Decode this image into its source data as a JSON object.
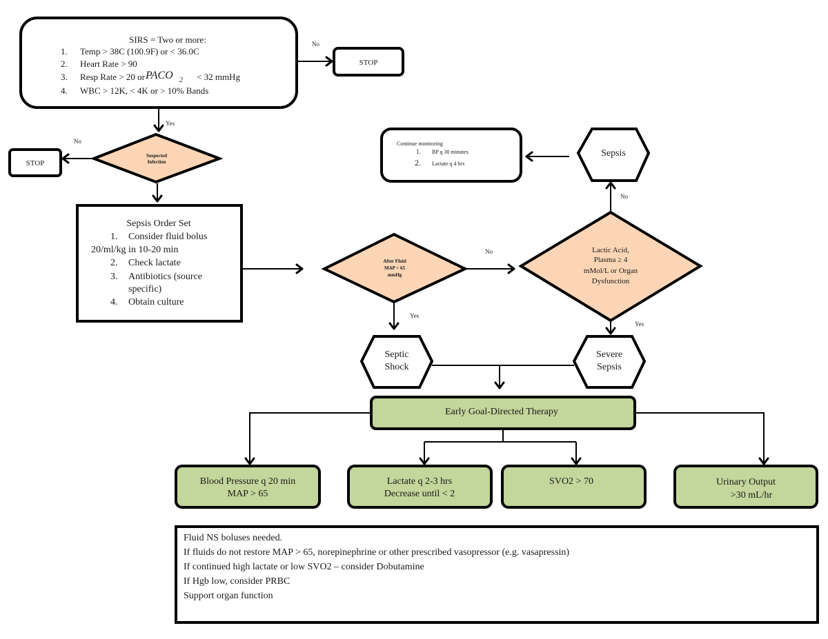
{
  "colors": {
    "decision_fill": "#fbd5b5",
    "therapy_fill": "#c3d69b",
    "stroke": "#000000"
  },
  "sirs": {
    "title": "SIRS = Two or more:",
    "items": [
      {
        "num": "1.",
        "text": "Temp > 38C (100.9F) or < 36.0C"
      },
      {
        "num": "2.",
        "text": "Heart Rate > 90"
      },
      {
        "num": "3.",
        "text": "Resp Rate > 20 or",
        "formula": "PACO",
        "formula_sub": "2",
        "suffix": "< 32 mmHg"
      },
      {
        "num": "4.",
        "text": "WBC > 12K, < 4K or > 10% Bands"
      }
    ]
  },
  "stop_top": {
    "label": "STOP"
  },
  "stop_left": {
    "label": "STOP"
  },
  "suspected_infection": {
    "line1": "Suspected",
    "line2": "Infection"
  },
  "order_set": {
    "title": "Sepsis Order Set",
    "item1_num": "1.",
    "item1_line1": "Consider fluid bolus",
    "item1_line2": "20/ml/kg in 10-20 min",
    "item2_num": "2.",
    "item2": "Check lactate",
    "item3_num": "3.",
    "item3_line1": "Antibiotics (source",
    "item3_line2": "specific)",
    "item4_num": "4.",
    "item4": "Obtain culture"
  },
  "after_fluid": {
    "line1": "After Fluid",
    "line2": "MAP < 65",
    "line3": "mmHg"
  },
  "lactic": {
    "line1": "Lactic Acid,",
    "line2": "Plasma ≥ 4",
    "line3": "mMol/L or Organ",
    "line4": "Dysfunction"
  },
  "sepsis": {
    "label": "Sepsis"
  },
  "continue_monitoring": {
    "title": "Continue monitoring",
    "items": [
      {
        "num": "1.",
        "text": "BP q 30 minutes"
      },
      {
        "num": "2.",
        "text": "Lactate q 4 hrs"
      }
    ]
  },
  "septic_shock": {
    "line1": "Septic",
    "line2": "Shock"
  },
  "severe_sepsis": {
    "line1": "Severe",
    "line2": "Sepsis"
  },
  "egdt": {
    "label": "Early Goal-Directed Therapy"
  },
  "goals": [
    {
      "line1": "Blood Pressure q 20 min",
      "line2": "MAP > 65"
    },
    {
      "line1": "Lactate q 2-3 hrs",
      "line2": "Decrease until < 2"
    },
    {
      "line1": "SVO2 > 70",
      "line2": ""
    },
    {
      "line1": "Urinary Output",
      "line2": ">30 mL/hr"
    }
  ],
  "edge_labels": {
    "sirs_no": "No",
    "sirs_yes": "Yes",
    "infection_no": "No",
    "map_no": "No",
    "map_yes": "Yes",
    "lactic_no": "No",
    "lactic_yes": "Yes"
  },
  "notes": [
    "Fluid NS boluses needed.",
    "If fluids do not restore MAP > 65, norepinephrine or other prescribed vasopressor (e.g. vasapressin)",
    "If continued high lactate or low SVO2 – consider Dobutamine",
    "If Hgb low, consider PRBC",
    "Support organ function"
  ]
}
